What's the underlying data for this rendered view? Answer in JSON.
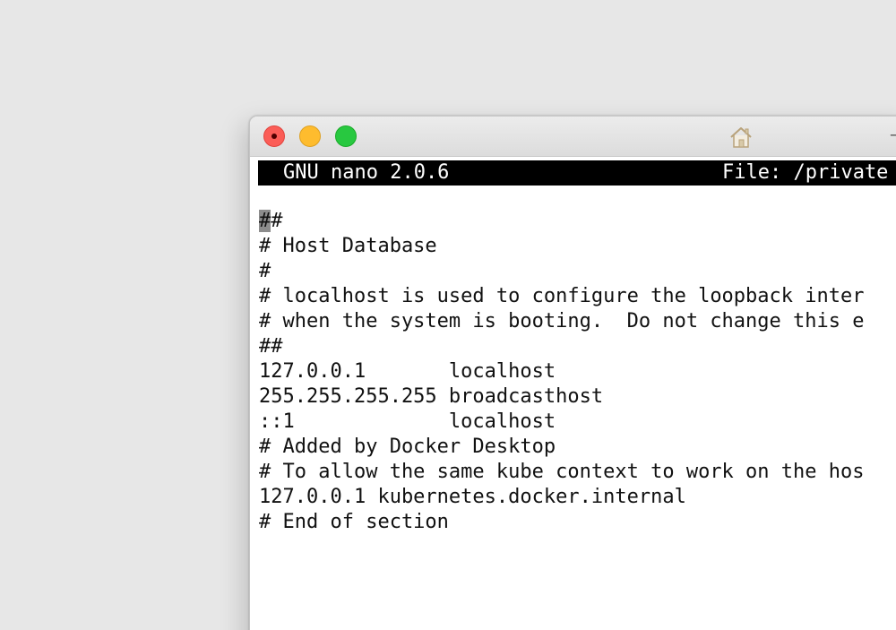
{
  "window": {
    "title_trailing": "–"
  },
  "nano": {
    "version": "GNU nano 2.0.6",
    "file": "File: /private"
  },
  "editor": {
    "cursor_char": "#",
    "lines": [
      "#",
      "# Host Database",
      "#",
      "# localhost is used to configure the loopback inter",
      "# when the system is booting.  Do not change this e",
      "##",
      "127.0.0.1       localhost",
      "255.255.255.255 broadcasthost",
      "::1             localhost",
      "# Added by Docker Desktop",
      "# To allow the same kube context to work on the hos",
      "127.0.0.1 kubernetes.docker.internal",
      "# End of section"
    ]
  },
  "icons": {
    "close": "close-icon",
    "minimize": "minimize-icon",
    "maximize": "maximize-icon",
    "home": "home-icon"
  },
  "colors": {
    "close": "#fb5d57",
    "minimize": "#febc2e",
    "maximize": "#28c840",
    "header_bg": "#000000",
    "header_fg": "#ffffff"
  }
}
